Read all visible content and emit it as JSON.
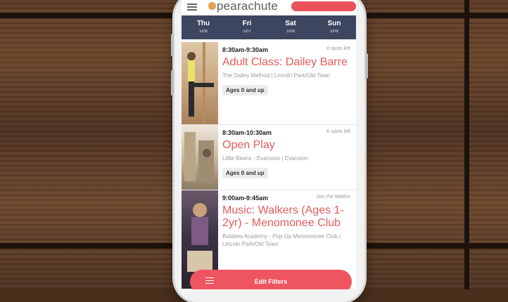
{
  "header": {
    "logo_text": "pearachute",
    "accent_color": "#e8505b"
  },
  "days": [
    {
      "name": "Thu",
      "date": "1/06"
    },
    {
      "name": "Fri",
      "date": "1/07"
    },
    {
      "name": "Sat",
      "date": "1/08"
    },
    {
      "name": "Sun",
      "date": "1/09"
    }
  ],
  "classes": [
    {
      "time": "8:30am-9:30am",
      "status": "8 spots left",
      "title": "Adult Class: Dailey Barre",
      "venue": "The Dailey Method | Lincoln Park/Old Town",
      "ages": "Ages 0 and up"
    },
    {
      "time": "8:30am-10:30am",
      "status": "8 spots left",
      "title": "Open Play",
      "venue": "Little Beans - Evanston | Evanston",
      "ages": "Ages 0 and up"
    },
    {
      "time": "9:00am-9:45am",
      "status": "Join the Waitlist",
      "title": "Music: Walkers (Ages 1-2yr) - Menomonee Club",
      "venue": "Bubbles Academy - Pop-Up Menomonee Club | Lincoln Park/Old Town",
      "ages": ""
    }
  ],
  "footer": {
    "edit_filters_label": "Edit Filters"
  }
}
